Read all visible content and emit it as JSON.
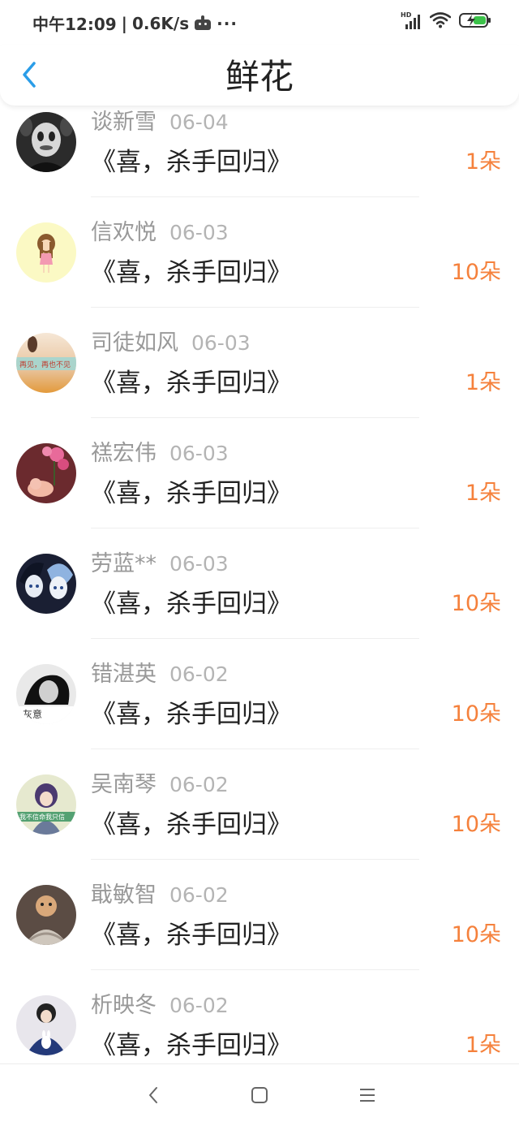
{
  "status_bar": {
    "time": "中午12:09",
    "separator": "|",
    "net_speed": "0.6K/s",
    "more": "···",
    "signal_label": "HD"
  },
  "header": {
    "title": "鲜花",
    "back_icon": "chevron-left-icon",
    "accent": "#2a9de8"
  },
  "items": [
    {
      "name": "谈新雪",
      "date": "06-04",
      "work": "《喜，杀手回归》",
      "count": "1朵"
    },
    {
      "name": "信欢悦",
      "date": "06-03",
      "work": "《喜，杀手回归》",
      "count": "10朵"
    },
    {
      "name": "司徒如风",
      "date": "06-03",
      "work": "《喜，杀手回归》",
      "count": "1朵"
    },
    {
      "name": "禚宏伟",
      "date": "06-03",
      "work": "《喜，杀手回归》",
      "count": "1朵"
    },
    {
      "name": "劳蓝**",
      "date": "06-03",
      "work": "《喜，杀手回归》",
      "count": "10朵"
    },
    {
      "name": "错湛英",
      "date": "06-02",
      "work": "《喜，杀手回归》",
      "count": "10朵"
    },
    {
      "name": "吴南琴",
      "date": "06-02",
      "work": "《喜，杀手回归》",
      "count": "10朵"
    },
    {
      "name": "戢敏智",
      "date": "06-02",
      "work": "《喜，杀手回归》",
      "count": "10朵"
    },
    {
      "name": "析映冬",
      "date": "06-02",
      "work": "《喜，杀手回归》",
      "count": "1朵"
    }
  ],
  "avatar_text": {
    "a3": "再见，再也不见",
    "a6": "灰意",
    "a7": "我不信命我只信"
  },
  "nav": {
    "back_icon": "nav-back-icon",
    "home_icon": "nav-home-icon",
    "menu_icon": "nav-menu-icon"
  },
  "colors": {
    "count": "#f5813c",
    "name": "#999999",
    "title": "#222222"
  }
}
